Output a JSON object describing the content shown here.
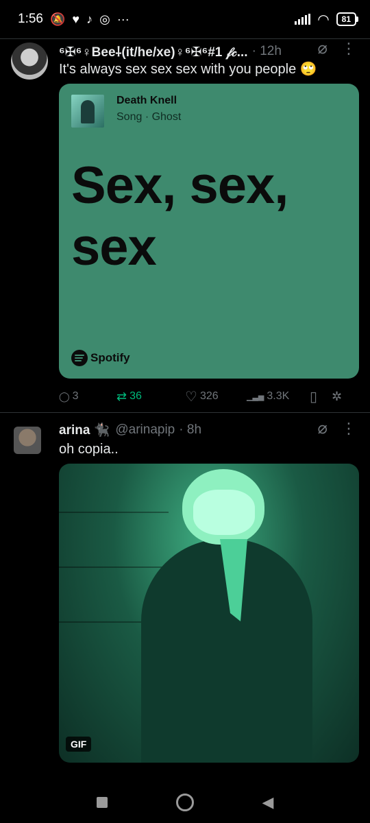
{
  "status_bar": {
    "time": "1:56",
    "battery": "81"
  },
  "tweets": [
    {
      "name": "⁶✠⁶♀Bee⸸(it/he/xe)♀⁶✠⁶#1 𝒻𝒸...",
      "handle": "",
      "time": "· 12h",
      "text": "It's always sex sex sex with you people 🙄",
      "card": {
        "song_title": "Death Knell",
        "song_meta": "Song · Ghost",
        "lyric": "Sex, sex, sex",
        "brand": "Spotify"
      },
      "actions": {
        "replies": "3",
        "reposts": "36",
        "likes": "326",
        "views": "3.3K"
      }
    },
    {
      "name": "arina 🐈‍⬛",
      "handle": "@arinapip",
      "time": "· 8h",
      "text": "oh copia..",
      "media_badge": "GIF"
    }
  ],
  "icons": {
    "reply": "◯",
    "repost": "⇄",
    "like": "♡",
    "views": "▁▃▅",
    "bookmark": "▯",
    "share": "✲",
    "grok": "⌀",
    "more": "⋮"
  },
  "colors": {
    "card_green": "#3e8a6e",
    "repost_green": "#00ba7c",
    "muted": "#71767b"
  }
}
